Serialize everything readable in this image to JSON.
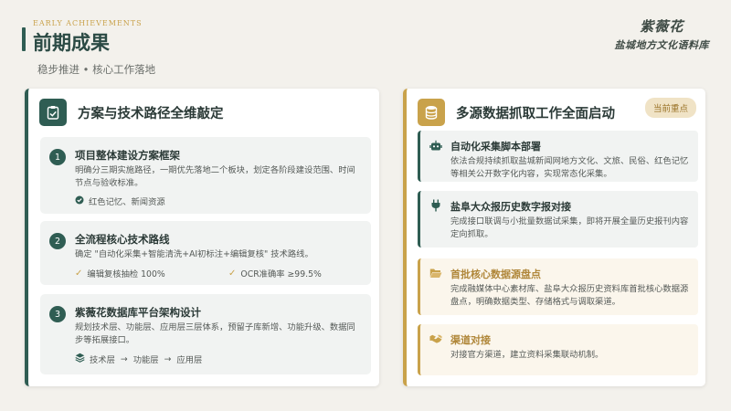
{
  "header": {
    "eyebrow": "EARLY ACHIEVEMENTS",
    "title": "前期成果",
    "subtitle": "稳步推进  •  核心工作落地",
    "brand_name": "紫薇花",
    "brand_sub": "盐城地方文化语料库"
  },
  "left_panel": {
    "icon": "clipboard-check-icon",
    "title": "方案与技术路径全维敲定",
    "steps": [
      {
        "number": "1",
        "title": "项目整体建设方案框架",
        "desc": "明确分三期实施路径，一期优先落地二个板块，划定各阶段建设范围、时间节点与验收标准。",
        "meta": "红色记忆、新闻资源"
      },
      {
        "number": "2",
        "title": "全流程核心技术路线",
        "desc": "确定 \"自动化采集+智能清洗+AI初标注+编辑复核\" 技术路线。",
        "metric1": "编辑复核抽检 100%",
        "metric2": "OCR准确率 ≥99.5%"
      },
      {
        "number": "3",
        "title": "紫薇花数据库平台架构设计",
        "desc": "规划技术层、功能层、应用层三层体系，预留子库新增、功能升级、数据同步等拓展接口。",
        "layer1": "技术层",
        "layer2": "功能层",
        "layer3": "应用层",
        "arrow": "→"
      }
    ]
  },
  "right_panel": {
    "icon": "database-icon",
    "title": "多源数据抓取工作全面启动",
    "badge": "当前重点",
    "cards": [
      {
        "icon": "robot-icon",
        "title": "自动化采集脚本部署",
        "desc": "依法合规持续抓取盐城新闻网地方文化、文旅、民俗、红色记忆等相关公开数字化内容，实现常态化采集。"
      },
      {
        "icon": "plug-icon",
        "title": "盐阜大众报历史数字报对接",
        "desc": "完成接口联调与小批量数据试采集，即将开展全量历史报刊内容定向抓取。"
      },
      {
        "icon": "folder-open-icon",
        "title": "首批核心数据源盘点",
        "desc": "完成融媒体中心素材库、盐阜大众报历史资料库首批核心数据源盘点，明确数据类型、存储格式与调取渠道。"
      },
      {
        "icon": "handshake-icon",
        "title": "渠道对接",
        "desc": "对接官方渠道，建立资料采集联动机制。"
      }
    ]
  },
  "colors": {
    "primary": "#2f5d53",
    "accent": "#c9a24b",
    "background": "#f3f1ec"
  }
}
